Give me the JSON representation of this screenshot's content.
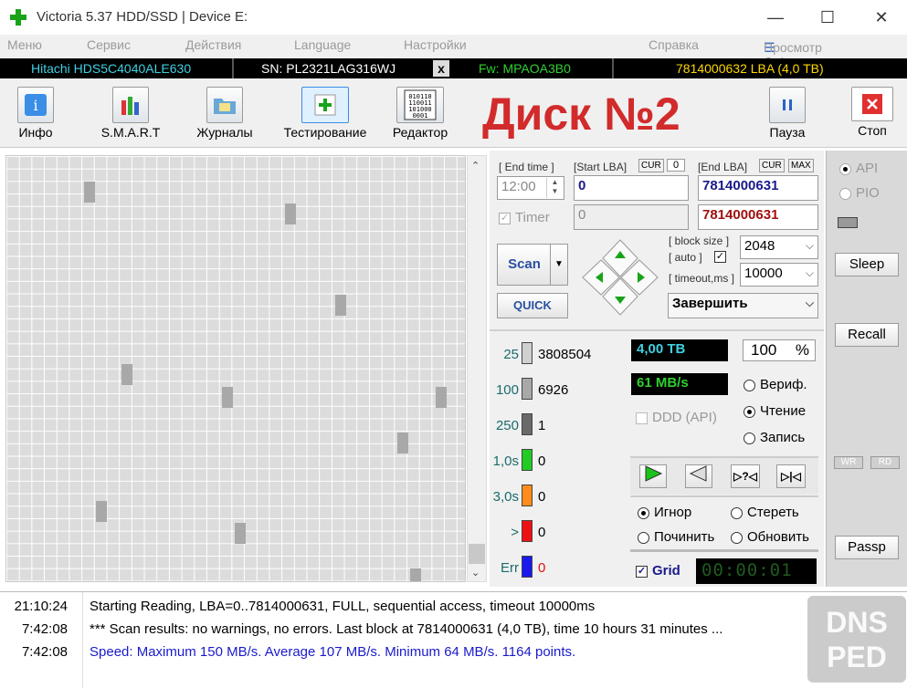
{
  "window": {
    "title": "Victoria 5.37 HDD/SSD | Device E:",
    "minimize": "—",
    "maximize": "☐",
    "close": "✕"
  },
  "menu": {
    "items": [
      "Меню",
      "Сервис",
      "Действия",
      "Language",
      "Настройки",
      "Справка"
    ],
    "buffer": "Просмотр буфера"
  },
  "device": {
    "model": "Hitachi HDS5C4040ALE630",
    "sn": "SN: PL2321LAG316WJ",
    "x": "x",
    "fw": "Fw: MPAOA3B0",
    "lba": "7814000632 LBA (4,0 TB)"
  },
  "toolbar": {
    "info": "Инфо",
    "smart": "S.M.A.R.T",
    "logs": "Журналы",
    "testing": "Тестирование",
    "editor": "Редактор",
    "pause": "Пауза",
    "stop": "Стоп"
  },
  "overlay_title": "Диск №2",
  "scan": {
    "end_time_label": "[ End time ]",
    "start_lba_label": "[Start LBA]",
    "cur": "CUR",
    "start_cur_val": "0",
    "end_lba_label": "[End LBA]",
    "max": "MAX",
    "time": "12:00",
    "start_lba": "0",
    "end_lba": "7814000631",
    "timer": "Timer",
    "timer_val": "0",
    "end_lba2": "7814000631",
    "scan_btn": "Scan",
    "quick_btn": "QUICK",
    "block_size_label": "[ block size ]",
    "auto_label": "[ auto ]",
    "block_size": "2048",
    "timeout_label": "[ timeout,ms ]",
    "timeout": "10000",
    "finish": "Завершить"
  },
  "stats": {
    "rows": [
      {
        "label": "25",
        "count": "3808504",
        "color": "#d0d0d0",
        "labelcolor": "#1a6b6b"
      },
      {
        "label": "100",
        "count": "6926",
        "color": "#a8a8a8",
        "labelcolor": "#1a6b6b"
      },
      {
        "label": "250",
        "count": "1",
        "color": "#6a6a6a",
        "labelcolor": "#1a6b6b"
      },
      {
        "label": "1,0s",
        "count": "0",
        "color": "#22cc22",
        "labelcolor": "#1a6b6b"
      },
      {
        "label": "3,0s",
        "count": "0",
        "color": "#ff8c1a",
        "labelcolor": "#1a6b6b"
      },
      {
        "label": ">",
        "count": "0",
        "color": "#ee1111",
        "labelcolor": "#1a6b6b"
      },
      {
        "label": "Err",
        "count": "0",
        "color": "#1a1aee",
        "labelcolor": "#1a6b6b"
      }
    ],
    "size": "4,00 TB",
    "percent": "100",
    "percent_sign": "%",
    "speed": "61 MB/s",
    "verify": "Вериф.",
    "read": "Чтение",
    "write": "Запись",
    "ddd": "DDD (API)",
    "ignore": "Игнор",
    "erase": "Стереть",
    "repair": "Починить",
    "refresh": "Обновить",
    "grid": "Grid",
    "clock": "00:00:01"
  },
  "side": {
    "api": "API",
    "pio": "PIO",
    "sleep": "Sleep",
    "recall": "Recall",
    "wr": "WR",
    "rd": "RD",
    "passp": "Passp"
  },
  "log": [
    {
      "time": "21:10:24",
      "msg": "Starting Reading, LBA=0..7814000631, FULL, sequential access, timeout 10000ms",
      "color": "#000000"
    },
    {
      "time": "7:42:08",
      "msg": "*** Scan results: no warnings, no errors. Last block at 7814000631 (4,0 TB), time 10 hours 31 minutes ...",
      "color": "#000000"
    },
    {
      "time": "7:42:08",
      "msg": "Speed: Maximum 150 MB/s. Average 107 MB/s. Minimum 64 MB/s. 1164 points.",
      "color": "#1a1acc"
    }
  ],
  "watermark": {
    "line1": "DNS",
    "line2": "PED"
  }
}
